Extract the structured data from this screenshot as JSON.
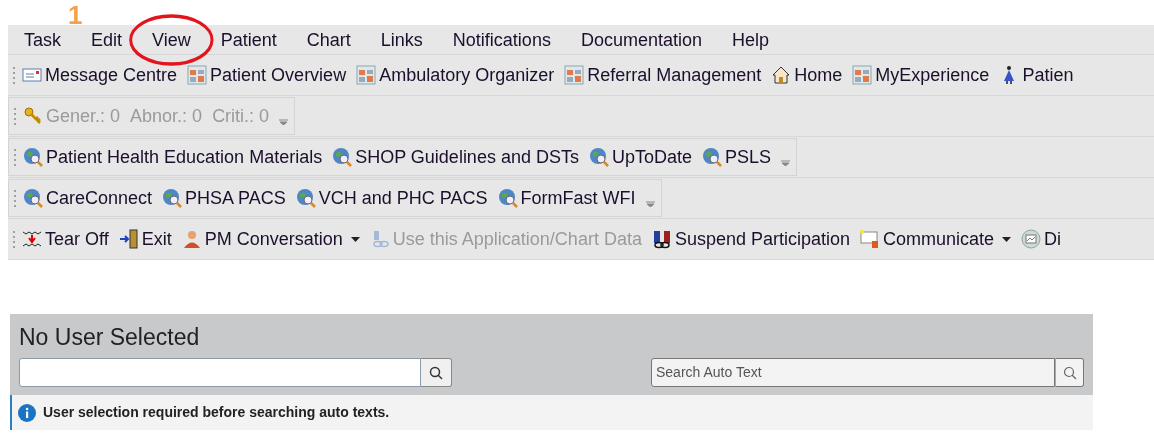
{
  "annotation": {
    "label": "1"
  },
  "menu": [
    {
      "label": "Task",
      "circled": false
    },
    {
      "label": "Edit",
      "circled": false
    },
    {
      "label": "View",
      "circled": true
    },
    {
      "label": "Patient",
      "circled": false
    },
    {
      "label": "Chart",
      "circled": false
    },
    {
      "label": "Links",
      "circled": false
    },
    {
      "label": "Notifications",
      "circled": false
    },
    {
      "label": "Documentation",
      "circled": false
    },
    {
      "label": "Help",
      "circled": false
    }
  ],
  "toolbars": [
    {
      "overflow": false,
      "items": [
        {
          "kind": "envelope",
          "label": "Message Centre",
          "disabled": false,
          "dropdown": false
        },
        {
          "kind": "report",
          "label": "Patient Overview",
          "disabled": false,
          "dropdown": false
        },
        {
          "kind": "report",
          "label": "Ambulatory Organizer",
          "disabled": false,
          "dropdown": false
        },
        {
          "kind": "report",
          "label": "Referral Management",
          "disabled": false,
          "dropdown": false
        },
        {
          "kind": "home",
          "label": "Home",
          "disabled": false,
          "dropdown": false
        },
        {
          "kind": "report",
          "label": "MyExperience",
          "disabled": false,
          "dropdown": false
        },
        {
          "kind": "figure",
          "label": "Patien",
          "disabled": false,
          "dropdown": false
        }
      ]
    },
    {
      "overflow": true,
      "items": [
        {
          "kind": "key",
          "label": "Gener.: 0",
          "disabled": true,
          "dropdown": false
        },
        {
          "kind": "none",
          "label": "Abnor.: 0",
          "disabled": true,
          "dropdown": false
        },
        {
          "kind": "none",
          "label": "Criti.: 0",
          "disabled": true,
          "dropdown": false
        }
      ]
    },
    {
      "overflow": true,
      "items": [
        {
          "kind": "globe",
          "label": "Patient Health Education Materials",
          "disabled": false,
          "dropdown": false
        },
        {
          "kind": "globe",
          "label": "SHOP Guidelines and DSTs",
          "disabled": false,
          "dropdown": false
        },
        {
          "kind": "globe",
          "label": "UpToDate",
          "disabled": false,
          "dropdown": false
        },
        {
          "kind": "globe",
          "label": "PSLS",
          "disabled": false,
          "dropdown": false
        }
      ]
    },
    {
      "overflow": true,
      "items": [
        {
          "kind": "globe",
          "label": "CareConnect",
          "disabled": false,
          "dropdown": false
        },
        {
          "kind": "globe",
          "label": "PHSA PACS",
          "disabled": false,
          "dropdown": false
        },
        {
          "kind": "globe",
          "label": "VCH and PHC PACS",
          "disabled": false,
          "dropdown": false
        },
        {
          "kind": "globe",
          "label": "FormFast WFI",
          "disabled": false,
          "dropdown": false
        }
      ]
    },
    {
      "overflow": false,
      "items": [
        {
          "kind": "tearoff",
          "label": "Tear Off",
          "disabled": false,
          "dropdown": false
        },
        {
          "kind": "exit",
          "label": "Exit",
          "disabled": false,
          "dropdown": false
        },
        {
          "kind": "person",
          "label": "PM Conversation",
          "disabled": false,
          "dropdown": true
        },
        {
          "kind": "link",
          "label": "Use this Application/Chart Data",
          "disabled": true,
          "dropdown": false
        },
        {
          "kind": "suspend",
          "label": "Suspend Participation",
          "disabled": false,
          "dropdown": false
        },
        {
          "kind": "communicate",
          "label": "Communicate",
          "disabled": false,
          "dropdown": true
        },
        {
          "kind": "display",
          "label": "Di",
          "disabled": false,
          "dropdown": false
        }
      ]
    }
  ],
  "panel": {
    "title": "No User Selected",
    "auto_text_search": {
      "placeholder": "Search Auto Text"
    },
    "message": "User selection required before searching auto texts."
  }
}
